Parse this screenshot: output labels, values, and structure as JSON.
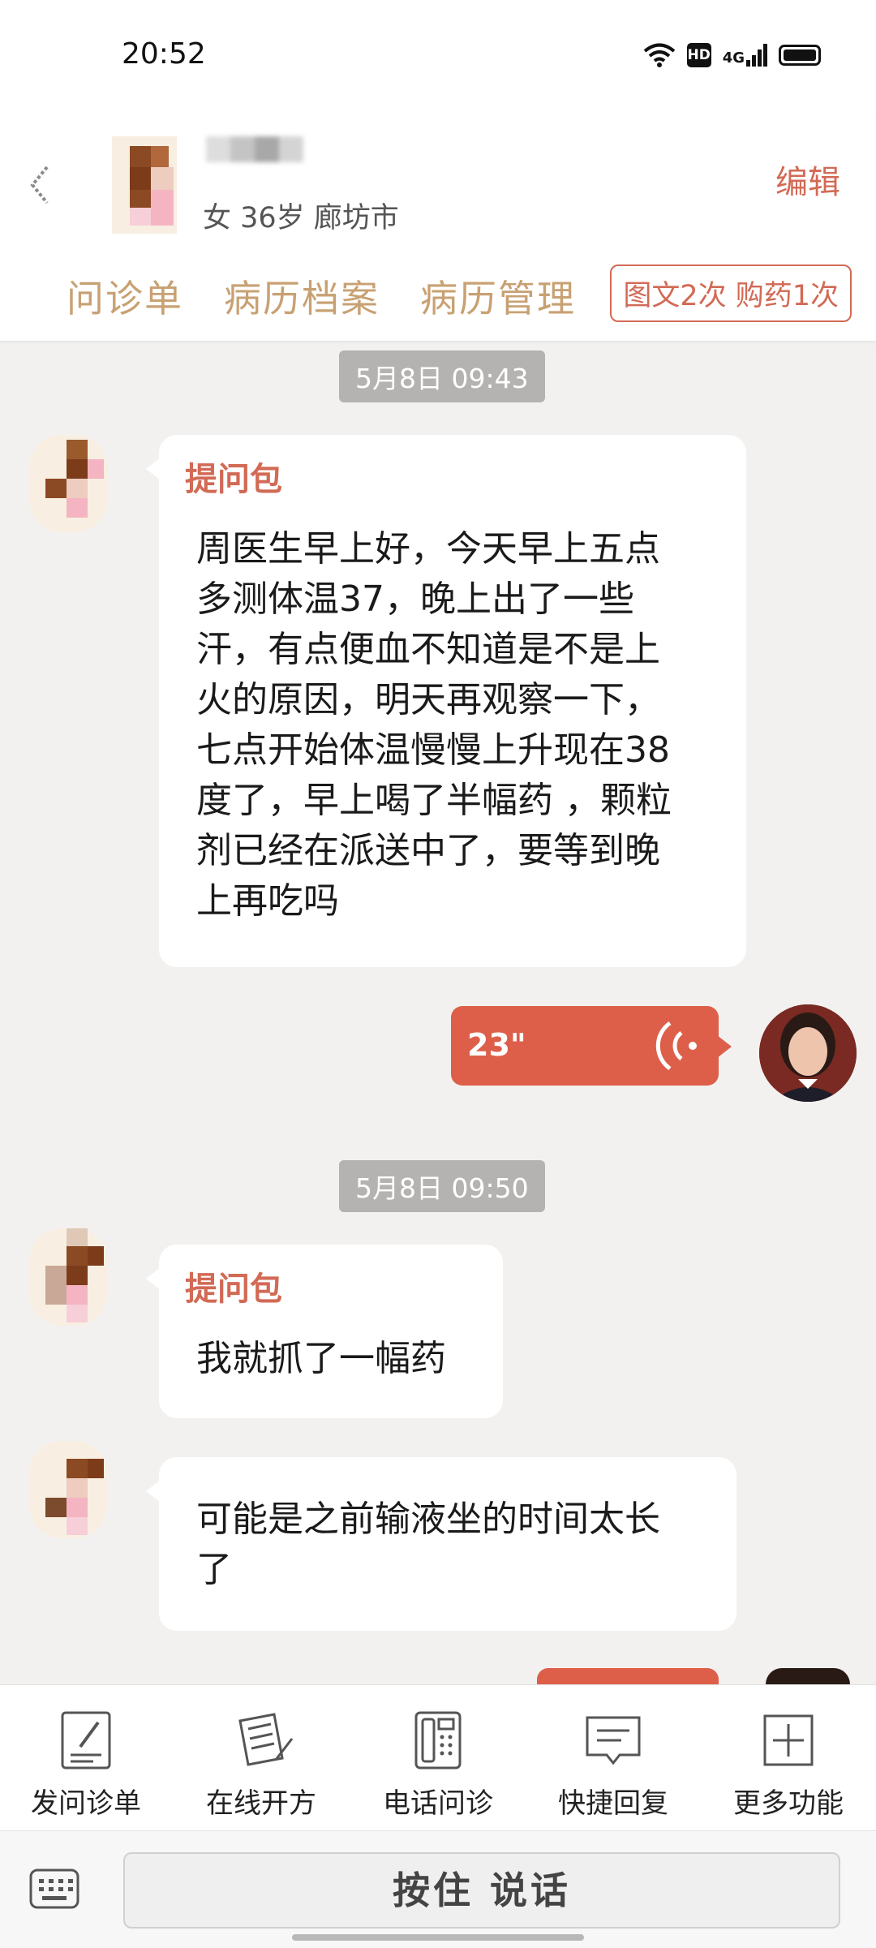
{
  "status_bar": {
    "time": "20:52",
    "hd_label": "HD",
    "network_label": "4G",
    "icons": [
      "wifi-icon",
      "hd-badge",
      "signal-icon",
      "battery-icon"
    ]
  },
  "header": {
    "patient_info": "女 36岁  廊坊市",
    "edit_label": "编辑",
    "tabs": [
      "问诊单",
      "病历档案",
      "病历管理"
    ],
    "package_label": "图文2次 购药1次"
  },
  "chat": {
    "messages": [
      {
        "timestamp": "5月8日 09:43"
      },
      {
        "title": "提问包",
        "lines": [
          "周医生早上好，今天早上五点",
          "多测体温37，晚上出了一些",
          "汗，有点便血不知道是不是上",
          "火的原因，明天再观察一下，",
          "七点开始体温慢慢上升现在38",
          "度了，早上喝了半幅药 ，颗粒",
          "剂已经在派送中了，要等到晚",
          "上再吃吗"
        ]
      },
      {
        "voice_duration": "23\""
      },
      {
        "timestamp": "5月8日 09:50"
      },
      {
        "title": "提问包",
        "lines": [
          "我就抓了一幅药"
        ]
      },
      {
        "lines": [
          "可能是之前输液坐的时间太长",
          "了"
        ]
      }
    ]
  },
  "toolbar": {
    "items": [
      {
        "label": "发问诊单",
        "icon": "form-pen-icon"
      },
      {
        "label": "在线开方",
        "icon": "prescription-icon"
      },
      {
        "label": "电话问诊",
        "icon": "phone-icon"
      },
      {
        "label": "快捷回复",
        "icon": "message-icon"
      },
      {
        "label": "更多功能",
        "icon": "plus-icon"
      }
    ]
  },
  "input_bar": {
    "hold_to_talk": "按住 说话",
    "keyboard_icon": "keyboard-icon"
  },
  "colors": {
    "accent_red": "#dd5f4a",
    "text_red": "#d26a55",
    "tab_gold": "#c8a173",
    "chat_bg": "#f3f1ef"
  }
}
